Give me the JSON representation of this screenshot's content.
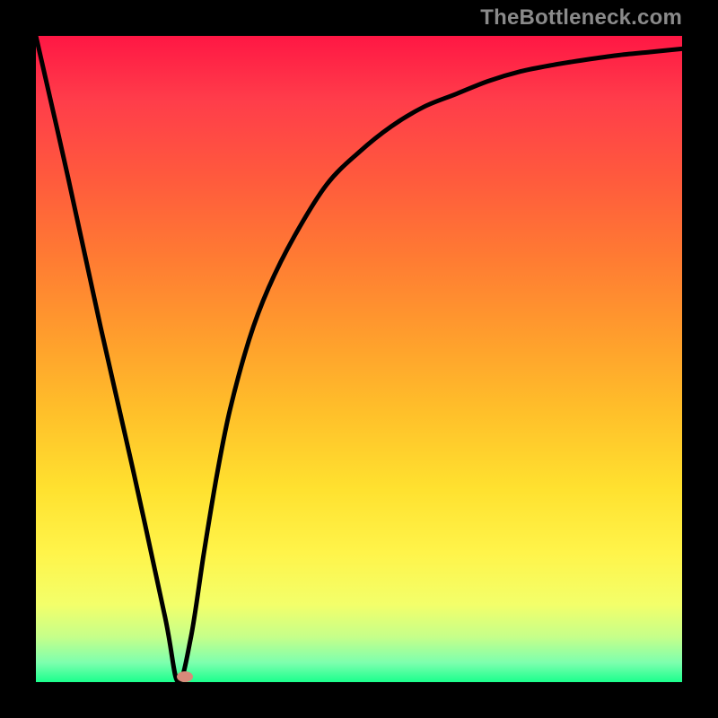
{
  "watermark": "TheBottleneck.com",
  "chart_data": {
    "type": "line",
    "title": "",
    "xlabel": "",
    "ylabel": "",
    "xlim": [
      0,
      100
    ],
    "ylim": [
      0,
      100
    ],
    "grid": false,
    "legend": false,
    "background_gradient": {
      "top": "#ff1744",
      "mid": "#ffd22d",
      "bottom": "#1bff8d"
    },
    "series": [
      {
        "name": "bottleneck-curve",
        "color": "#000000",
        "x": [
          0,
          5,
          10,
          15,
          20,
          22,
          24,
          26,
          28,
          30,
          33,
          36,
          40,
          45,
          50,
          55,
          60,
          65,
          70,
          75,
          80,
          85,
          90,
          95,
          100
        ],
        "y": [
          100,
          78,
          55,
          33,
          10,
          0,
          7,
          20,
          32,
          42,
          53,
          61,
          69,
          77,
          82,
          86,
          89,
          91,
          93,
          94.5,
          95.5,
          96.3,
          97,
          97.5,
          98
        ]
      }
    ],
    "marker": {
      "name": "optimal-point",
      "x_pct": 23,
      "y_pct": 0.8,
      "color": "#d98a7a"
    }
  }
}
